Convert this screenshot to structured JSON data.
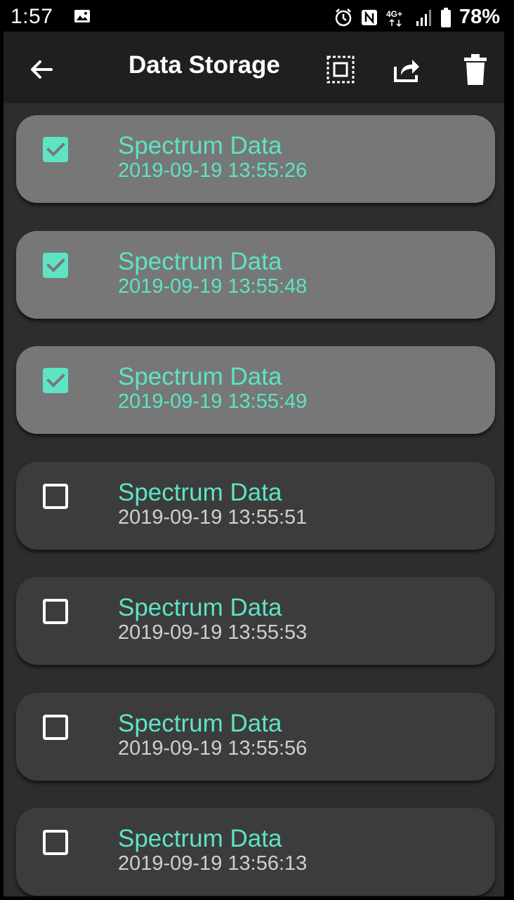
{
  "status_bar": {
    "time": "1:57",
    "battery_percent": "78%",
    "icons": [
      "image-icon",
      "alarm-icon",
      "nfc-icon",
      "network-4g-icon",
      "signal-icon",
      "battery-icon"
    ]
  },
  "app_bar": {
    "title": "Data Storage",
    "icons": [
      "back-arrow-icon",
      "select-all-icon",
      "share-icon",
      "delete-icon"
    ]
  },
  "colors": {
    "accent": "#5ee3c5",
    "selected_card": "#777777",
    "unselected_card": "#3c3c3c",
    "background": "#2d2d2d",
    "app_bar": "#1f1f1f"
  },
  "items": [
    {
      "title": "Spectrum Data",
      "timestamp": "2019-09-19 13:55:26",
      "checked": true
    },
    {
      "title": "Spectrum Data",
      "timestamp": "2019-09-19 13:55:48",
      "checked": true
    },
    {
      "title": "Spectrum Data",
      "timestamp": "2019-09-19 13:55:49",
      "checked": true
    },
    {
      "title": "Spectrum Data",
      "timestamp": "2019-09-19 13:55:51",
      "checked": false
    },
    {
      "title": "Spectrum Data",
      "timestamp": "2019-09-19 13:55:53",
      "checked": false
    },
    {
      "title": "Spectrum Data",
      "timestamp": "2019-09-19 13:55:56",
      "checked": false
    },
    {
      "title": "Spectrum Data",
      "timestamp": "2019-09-19 13:56:13",
      "checked": false
    }
  ]
}
